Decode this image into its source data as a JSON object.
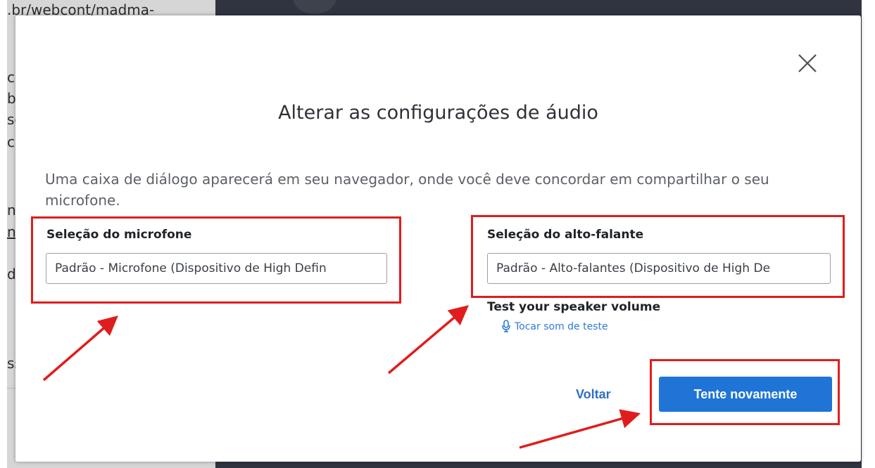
{
  "background": {
    "url_fragment": ".br/webcont/madma-",
    "text_fragments": [
      "cr",
      "b",
      "se",
      "c",
      "n",
      "nf",
      "d",
      "ss"
    ]
  },
  "dialog": {
    "title": "Alterar as configurações de áudio",
    "description": "Uma caixa de diálogo aparecerá em seu navegador, onde você deve concordar em compartilhar o seu microfone.",
    "microphone": {
      "label": "Seleção do microfone",
      "value": "Padrão - Microfone (Dispositivo de High Defin"
    },
    "speaker": {
      "label": "Seleção do alto-falante",
      "value": "Padrão - Alto-falantes (Dispositivo de High De"
    },
    "speaker_test": {
      "label": "Test your speaker volume",
      "link": "Tocar som de teste",
      "icon": "microphone-icon"
    },
    "buttons": {
      "back": "Voltar",
      "retry": "Tente novamente"
    }
  },
  "colors": {
    "primary_button": "#1f74d6",
    "link": "#2f7bd1",
    "annotation_red": "#e01d1d"
  }
}
